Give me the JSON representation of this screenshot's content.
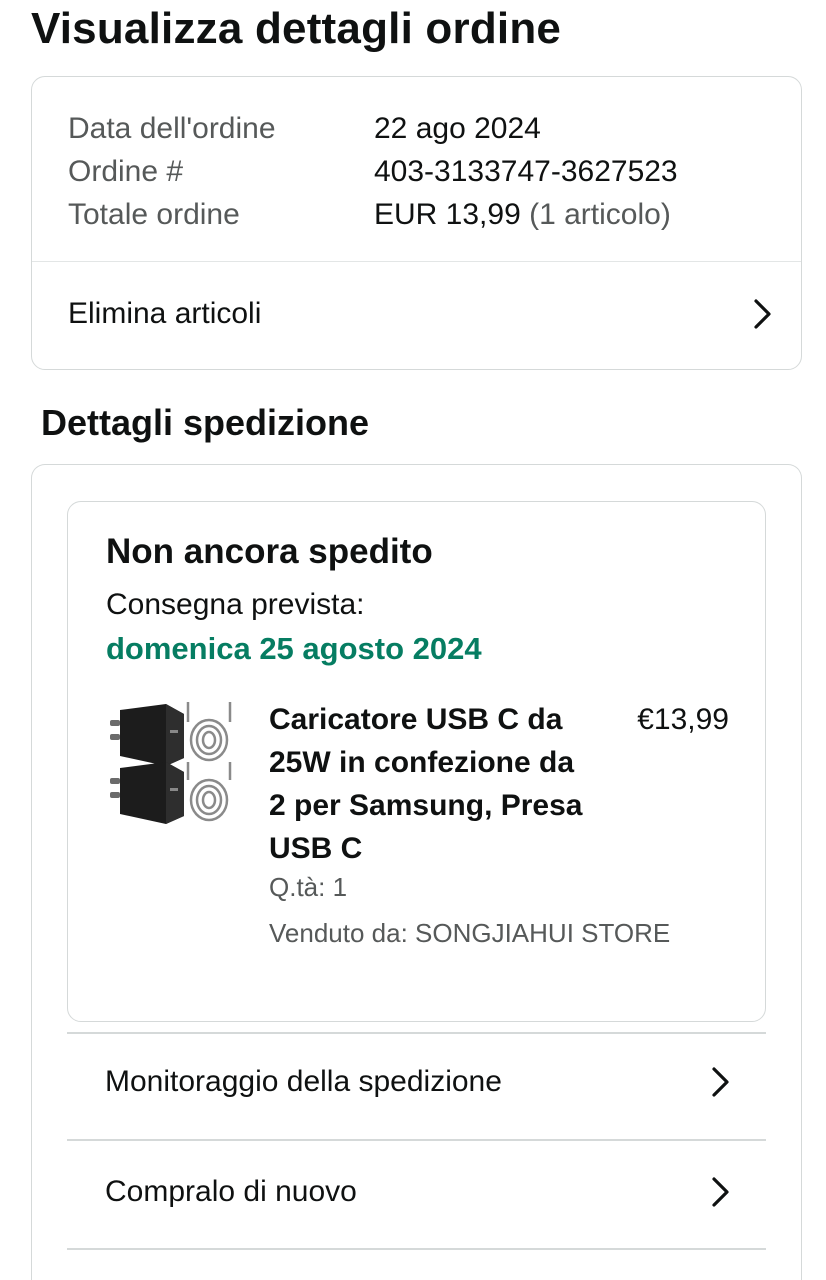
{
  "page": {
    "title": "Visualizza dettagli ordine"
  },
  "order": {
    "date_label": "Data dell'ordine",
    "date_value": "22 ago 2024",
    "number_label": "Ordine #",
    "number_value": "403-3133747-3627523",
    "total_label": "Totale ordine",
    "total_value": "EUR 13,99",
    "total_items": "(1 articolo)",
    "delete_items_label": "Elimina articoli"
  },
  "shipping": {
    "section_title": "Dettagli spedizione",
    "status": "Non ancora spedito",
    "delivery_label": "Consegna prevista:",
    "delivery_date": "domenica 25 agosto 2024",
    "product": {
      "title": "Caricatore USB C da 25W in confezione da 2 per Samsung, Presa USB C",
      "price": "€13,99",
      "quantity": "Q.tà: 1",
      "seller": "Venduto da: SONGJIAHUI STORE",
      "image_icon": "usb-charger-product-image"
    },
    "track_label": "Monitoraggio della spedizione",
    "buy_again_label": "Compralo di nuovo"
  },
  "colors": {
    "text": "#0f1111",
    "muted": "#565959",
    "delivery_green": "#067d62",
    "border": "#d5d9d9"
  },
  "icons": {
    "chevron": "chevron-right-icon"
  }
}
